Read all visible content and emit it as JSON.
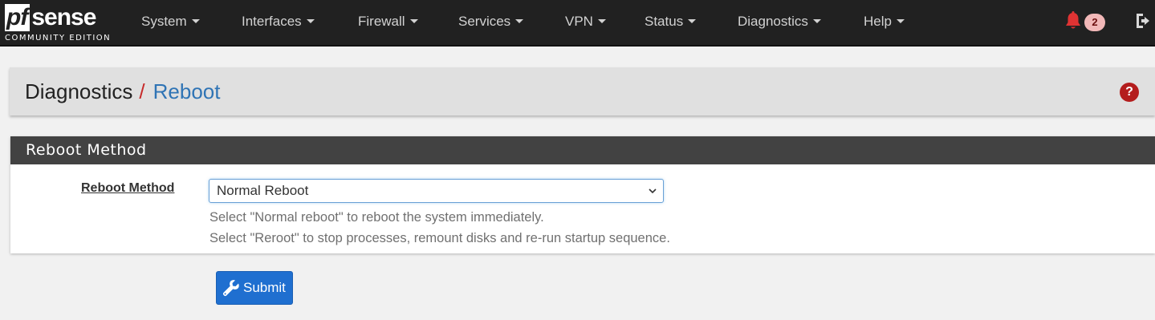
{
  "logo": {
    "pf": "pf",
    "sense": "sense",
    "edition": "COMMUNITY EDITION"
  },
  "nav": {
    "items": [
      {
        "label": "System"
      },
      {
        "label": "Interfaces"
      },
      {
        "label": "Firewall"
      },
      {
        "label": "Services"
      },
      {
        "label": "VPN"
      },
      {
        "label": "Status"
      },
      {
        "label": "Diagnostics"
      },
      {
        "label": "Help"
      }
    ],
    "notification_count": "2",
    "icons": {
      "notifications": "bell-icon",
      "logout": "sign-out-icon"
    }
  },
  "breadcrumb": {
    "first": "Diagnostics",
    "separator": "/",
    "current": "Reboot",
    "help": "?"
  },
  "panel": {
    "title": "Reboot Method",
    "field_label": "Reboot Method",
    "select_value": "Normal Reboot",
    "help_lines": [
      "Select \"Normal reboot\" to reboot the system immediately.",
      "Select \"Reroot\" to stop processes, remount disks and re-run startup sequence."
    ]
  },
  "submit": {
    "label": "Submit",
    "icon": "wrench-icon"
  },
  "colors": {
    "navbar": "#212121",
    "accent_blue": "#2f74b5",
    "button_blue": "#1f6fd0",
    "alert_red": "#b41d1d",
    "panel_heading": "#424242"
  }
}
